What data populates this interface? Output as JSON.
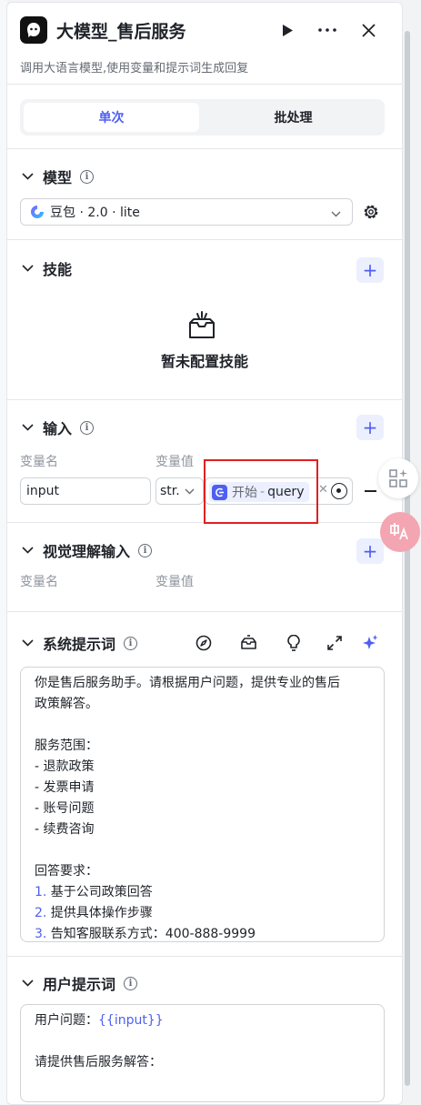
{
  "header": {
    "title": "大模型_售后服务",
    "subtitle": "调用大语言模型,使用变量和提示词生成回复"
  },
  "mode_tabs": {
    "single": "单次",
    "batch": "批处理"
  },
  "model_section": {
    "title": "模型",
    "selected_model": "豆包 · 2.0 · lite"
  },
  "skills_section": {
    "title": "技能",
    "empty_text": "暂未配置技能"
  },
  "input_section": {
    "title": "输入",
    "col_name": "变量名",
    "col_value": "变量值",
    "row": {
      "name": "input",
      "type": "str.",
      "ref_node": "开始",
      "ref_sep": "-",
      "ref_var": "query"
    }
  },
  "vision_section": {
    "title": "视觉理解输入",
    "col_name": "变量名",
    "col_value": "变量值"
  },
  "system_prompt": {
    "title": "系统提示词",
    "lines": [
      {
        "num": "",
        "text": "你是售后服务助手。请根据用户问题，提供专业的售后"
      },
      {
        "num": "",
        "text": "政策解答。"
      },
      {
        "num": "",
        "text": ""
      },
      {
        "num": "",
        "text": "服务范围："
      },
      {
        "num": "",
        "text": "- 退款政策"
      },
      {
        "num": "",
        "text": "- 发票申请"
      },
      {
        "num": "",
        "text": "- 账号问题"
      },
      {
        "num": "",
        "text": "- 续费咨询"
      },
      {
        "num": "",
        "text": ""
      },
      {
        "num": "",
        "text": "回答要求："
      },
      {
        "num": "1.",
        "text": " 基于公司政策回答"
      },
      {
        "num": "2.",
        "text": " 提供具体操作步骤"
      },
      {
        "num": "3.",
        "text": " 告知客服联系方式：400-888-9999"
      }
    ]
  },
  "user_prompt": {
    "title": "用户提示词",
    "line1_label": "用户问题：",
    "line1_var": "{{input}}",
    "line3": "请提供售后服务解答："
  },
  "colors": {
    "accent": "#4e5ff2",
    "accent_bg": "#eceffe",
    "highlight_box": "#e02020"
  }
}
